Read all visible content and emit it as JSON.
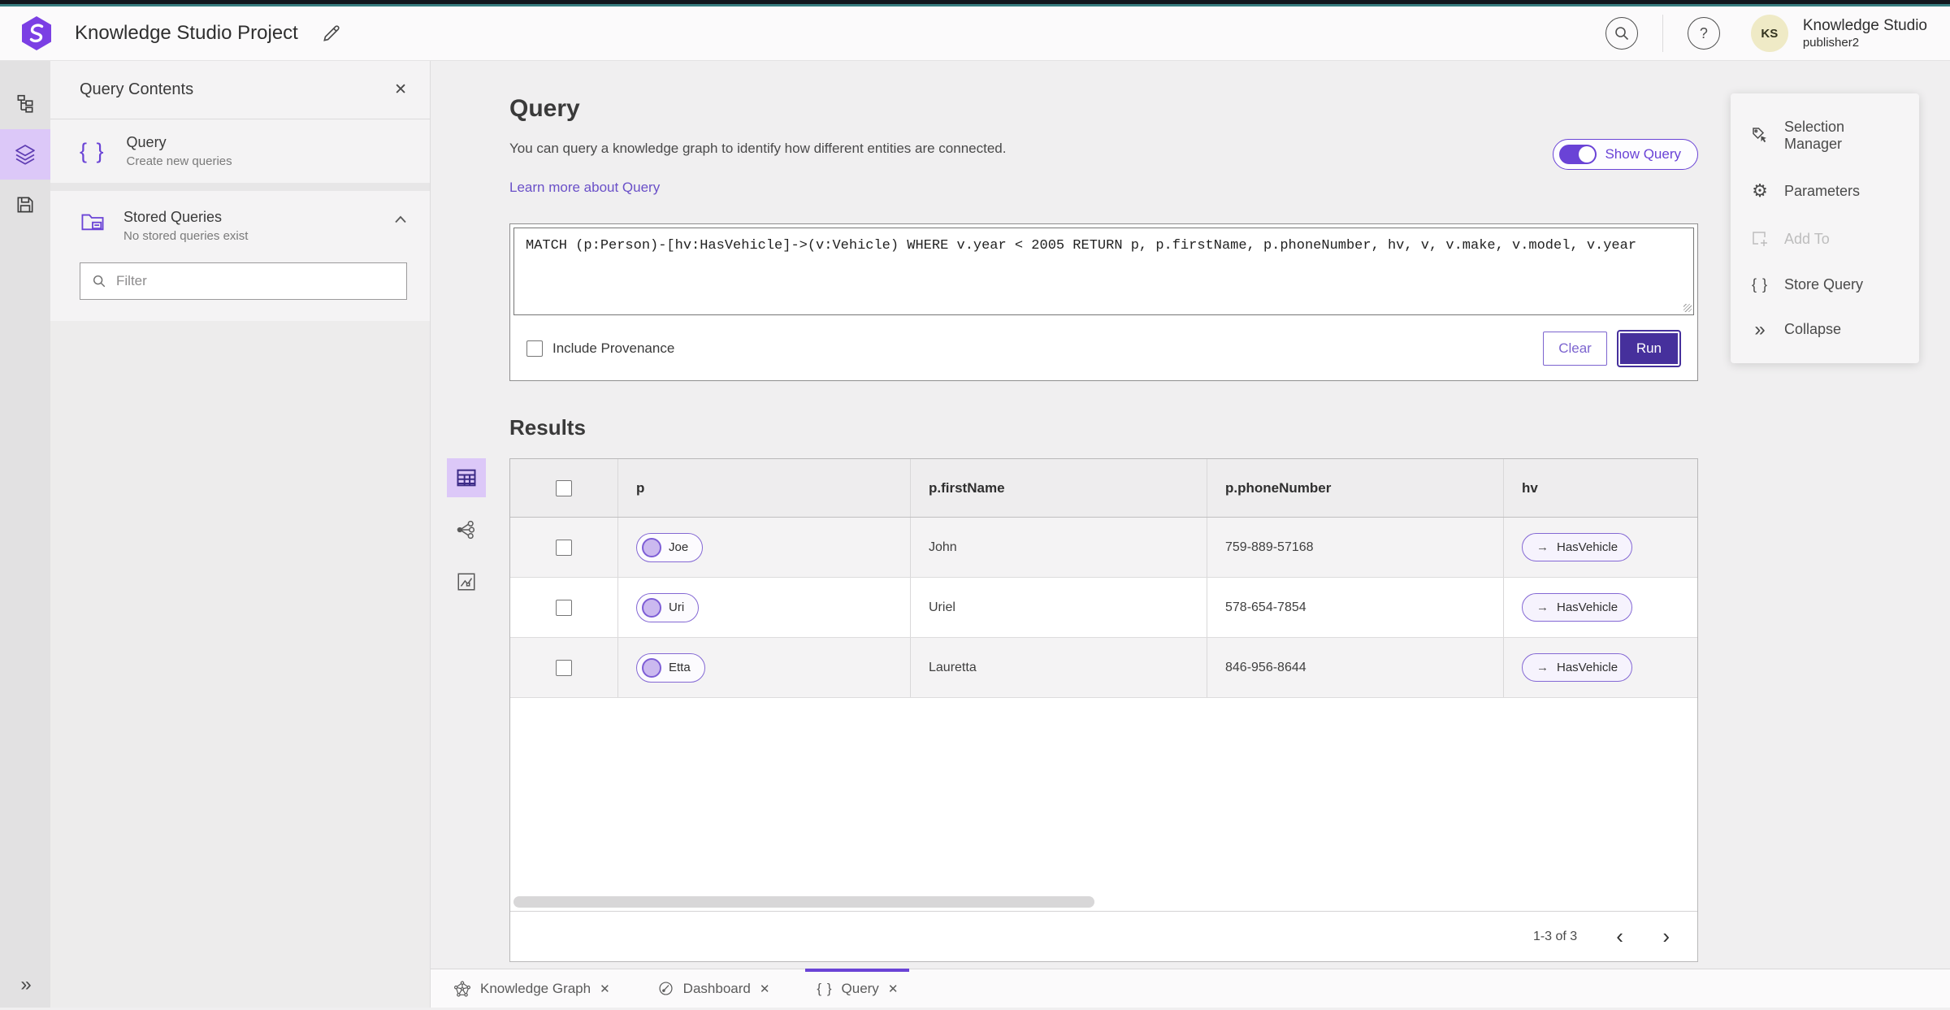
{
  "header": {
    "app_title": "Knowledge Studio Project",
    "user_name": "Knowledge Studio",
    "user_role": "publisher2",
    "avatar_initials": "KS"
  },
  "sidebar": {
    "panel_title": "Query Contents",
    "query_item_title": "Query",
    "query_item_subtitle": "Create new queries",
    "stored_title": "Stored Queries",
    "stored_subtitle": "No stored queries exist",
    "filter_placeholder": "Filter"
  },
  "query": {
    "title": "Query",
    "description": "You can query a knowledge graph to identify how different entities are connected.",
    "learn_more": "Learn more about Query",
    "show_query": "Show Query",
    "text": "MATCH (p:Person)-[hv:HasVehicle]->(v:Vehicle) WHERE v.year < 2005 RETURN p, p.firstName, p.phoneNumber, hv, v, v.make, v.model, v.year",
    "include_provenance": "Include Provenance",
    "clear": "Clear",
    "run": "Run"
  },
  "results": {
    "title": "Results",
    "columns": [
      "p",
      "p.firstName",
      "p.phoneNumber",
      "hv"
    ],
    "rows": [
      {
        "p": "Joe",
        "firstName": "John",
        "phone": "759-889-57168",
        "hv": "HasVehicle"
      },
      {
        "p": "Uri",
        "firstName": "Uriel",
        "phone": "578-654-7854",
        "hv": "HasVehicle"
      },
      {
        "p": "Etta",
        "firstName": "Lauretta",
        "phone": "846-956-8644",
        "hv": "HasVehicle"
      }
    ],
    "pagination": "1-3 of 3"
  },
  "right_panel": {
    "selection_manager": "Selection Manager",
    "parameters": "Parameters",
    "add_to": "Add To",
    "store_query": "Store Query",
    "collapse": "Collapse"
  },
  "tabs": {
    "knowledge_graph": "Knowledge Graph",
    "dashboard": "Dashboard",
    "query": "Query"
  },
  "icons": {
    "braces": "{ }",
    "gear": "⚙",
    "arrow_right": "→",
    "close": "✕",
    "tab_close": "✕",
    "help": "?",
    "collapse": "»",
    "expand": "»",
    "chevron_left": "‹",
    "chevron_right": "›"
  },
  "colors": {
    "accent": "#6a43d6",
    "run_button": "#46309c",
    "teal_strip": "#377c7f",
    "rail_active": "#dcc8f8"
  }
}
